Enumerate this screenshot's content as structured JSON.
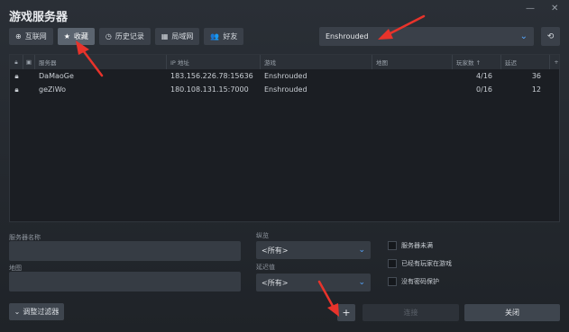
{
  "window": {
    "title": "游戏服务器"
  },
  "tabs": [
    {
      "label": "互联网",
      "icon": "globe-icon",
      "glyph": "⊕"
    },
    {
      "label": "收藏",
      "icon": "star-icon",
      "glyph": "★"
    },
    {
      "label": "历史记录",
      "icon": "clock-icon",
      "glyph": "◷"
    },
    {
      "label": "局域网",
      "icon": "lan-icon",
      "glyph": "▦"
    },
    {
      "label": "好友",
      "icon": "friends-icon",
      "glyph": "👥"
    }
  ],
  "game_select": {
    "value": "Enshrouded"
  },
  "columns": {
    "name": "服务器",
    "ip": "IP 地址",
    "game": "游戏",
    "map": "地图",
    "players": "玩家数 ↑",
    "ping": "延迟",
    "add": "+"
  },
  "servers": [
    {
      "name": "DaMaoGe",
      "ip": "183.156.226.78:15636",
      "game": "Enshrouded",
      "map": "",
      "players": "4/16",
      "ping": "36"
    },
    {
      "name": "geZiWo",
      "ip": "180.108.131.15:7000",
      "game": "Enshrouded",
      "map": "",
      "players": "0/16",
      "ping": "12"
    }
  ],
  "filters": {
    "server_name_label": "服务器名称",
    "map_label": "地图",
    "location_label": "纵览",
    "location_value": "<所有>",
    "latency_label": "延迟值",
    "latency_value": "<所有>",
    "checkbox_not_full": "服务器未满",
    "checkbox_has_players": "已经有玩家在游戏",
    "checkbox_no_password": "没有密码保护"
  },
  "buttons": {
    "change_filters": "调整过滤器",
    "add": "+",
    "connect": "连接",
    "close": "关闭"
  },
  "colors": {
    "accent": "#56a6ff",
    "annotation": "#e8332b"
  }
}
